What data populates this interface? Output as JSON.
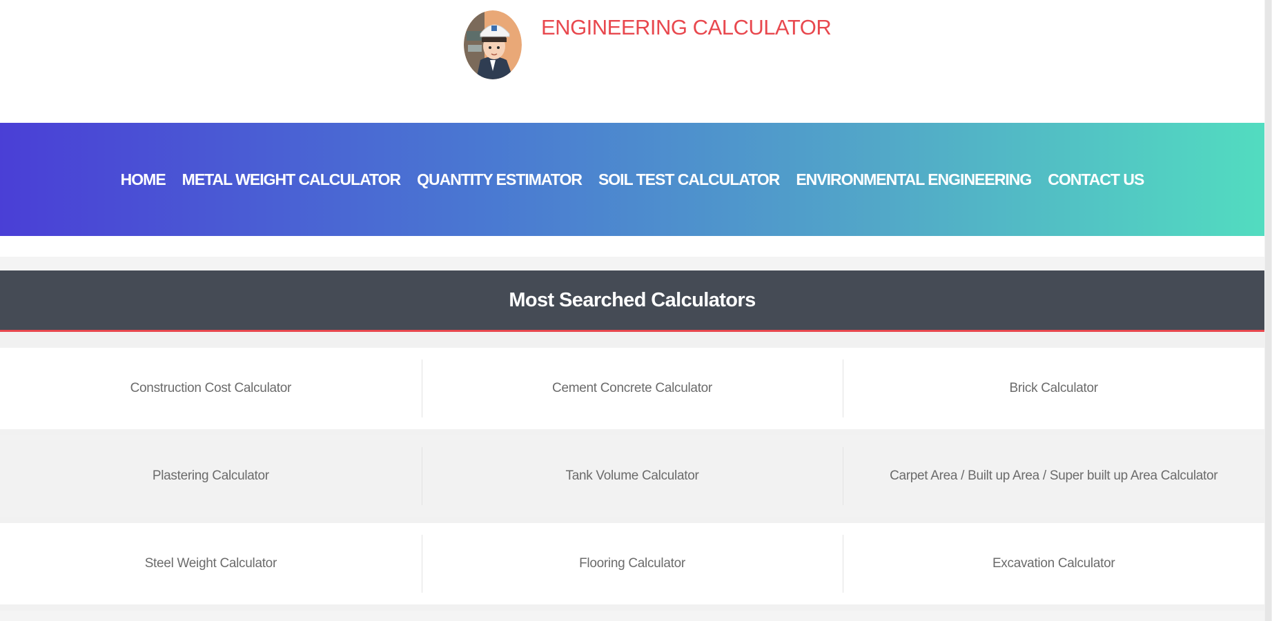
{
  "header": {
    "site_title": "ENGINEERING CALCULATOR",
    "logo_icon": "engineer-avatar-logo"
  },
  "nav": {
    "items": [
      {
        "label": "HOME"
      },
      {
        "label": "METAL WEIGHT CALCULATOR"
      },
      {
        "label": "QUANTITY ESTIMATOR"
      },
      {
        "label": "SOIL TEST CALCULATOR"
      },
      {
        "label": "ENVIRONMENTAL ENGINEERING"
      },
      {
        "label": "CONTACT US"
      }
    ]
  },
  "section": {
    "title": "Most Searched Calculators"
  },
  "calculators": {
    "rows": [
      {
        "cells": [
          {
            "label": "Construction Cost Calculator"
          },
          {
            "label": "Cement Concrete Calculator"
          },
          {
            "label": "Brick Calculator"
          }
        ]
      },
      {
        "cells": [
          {
            "label": "Plastering Calculator"
          },
          {
            "label": "Tank Volume Calculator"
          },
          {
            "label": "Carpet Area / Built up Area / Super built up Area Calculator"
          }
        ]
      },
      {
        "cells": [
          {
            "label": "Steel Weight Calculator"
          },
          {
            "label": "Flooring Calculator"
          },
          {
            "label": "Excavation Calculator"
          }
        ]
      }
    ]
  },
  "colors": {
    "title_red": "#e8484e",
    "nav_gradient_start": "#4a3fd6",
    "nav_gradient_end": "#52dcc0",
    "section_header_bg": "#454b55"
  }
}
